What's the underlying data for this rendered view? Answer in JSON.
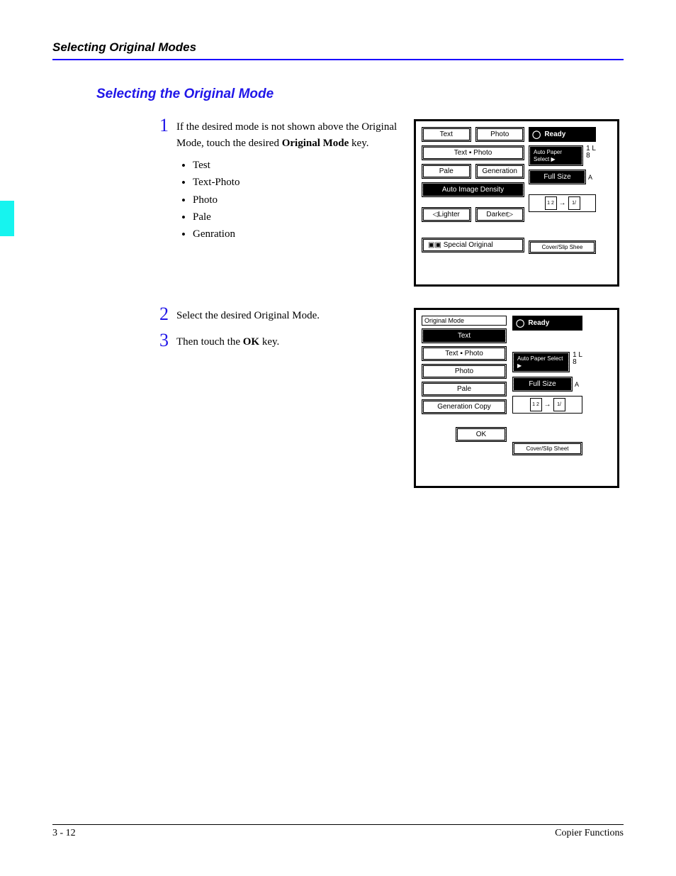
{
  "running_head": "Selecting Original Modes",
  "section_title": "Selecting the Original Mode",
  "steps": {
    "s1": {
      "num": "1",
      "text_a": "If the desired mode is not shown above the Original Mode, touch the desired ",
      "bold1": "Original Mode",
      "text_b": " key.",
      "bullets": [
        "Test",
        "Text-Photo",
        "Photo",
        "Pale",
        "Genration"
      ]
    },
    "s2": {
      "num": "2",
      "text": "Select the desired Original Mode."
    },
    "s3": {
      "num": "3",
      "text_a": "Then touch the ",
      "bold1": "OK",
      "text_b": " key."
    }
  },
  "panel1": {
    "ready": "Ready",
    "text": "Text",
    "photo": "Photo",
    "textphoto": "Text ▪ Photo",
    "pale": "Pale",
    "generation": "Generation",
    "autoimg": "Auto Image Density",
    "lighter": "◁Lighter",
    "darker": "Darker▷",
    "special": "Special Original",
    "autopaper": "Auto Paper Select ▶",
    "fullsize": "Full Size",
    "cover": "Cover/Slip Shee",
    "a": "A",
    "frac_top": "1 L",
    "frac_bot": "8"
  },
  "panel2": {
    "head": "Original Mode",
    "ready": "Ready",
    "text": "Text",
    "textphoto": "Text ▪ Photo",
    "photo": "Photo",
    "pale": "Pale",
    "gencopy": "Generation Copy",
    "ok": "OK",
    "autopaper": "Auto Paper Select ▶",
    "fullsize": "Full Size",
    "cover": "Cover/Slip Sheet",
    "a": "A",
    "frac_top": "1 L",
    "frac_bot": "8"
  },
  "footer": {
    "page": "3 - 12",
    "chapter": "Copier Functions"
  }
}
